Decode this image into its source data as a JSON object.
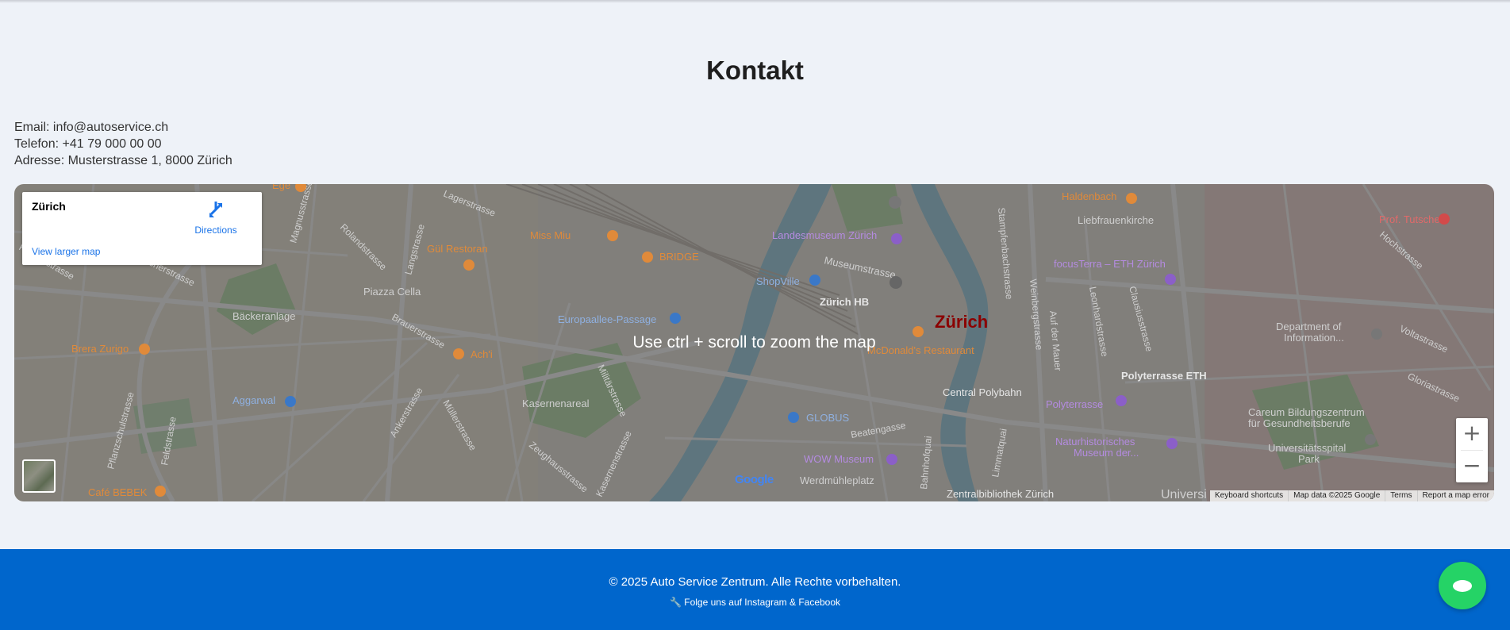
{
  "page": {
    "title": "Kontakt"
  },
  "contact": {
    "email": "Email: info@autoservice.ch",
    "phone": "Telefon: +41 79 000 00 00",
    "address": "Adresse: Musterstrasse 1, 8000 Zürich"
  },
  "map": {
    "scroll_hint": "Use ctrl + scroll to zoom the map",
    "place_name": "Zürich",
    "directions_label": "Directions",
    "larger_map_label": "View larger map",
    "zoom_in": "+",
    "zoom_out": "−",
    "logo_text": "Google",
    "attribution": {
      "shortcuts": "Keyboard shortcuts",
      "data": "Map data ©2025 Google",
      "terms": "Terms",
      "report": "Report a map error"
    },
    "labels": {
      "zurich": "Zürich",
      "zurich_hb": "Zürich HB",
      "landesmuseum": "Landesmuseum Zürich",
      "shopville": "ShopVille",
      "museumstrasse": "Museumstrasse",
      "liebfrauenkirche": "Liebfrauenkirche",
      "haldenbach": "Haldenbach",
      "focusterra": "focusTerra – ETH Zürich",
      "tutschek": "Prof. Tutschek",
      "miss_miu": "Miss Miu",
      "gul": "Gül Restoran",
      "bridge": "BRIDGE",
      "piazza": "Piazza Cella",
      "baeckeranlage": "Bäckeranlage",
      "europaallee": "Europaallee-Passage",
      "brera": "Brera Zurigo",
      "achi": "Ach'i",
      "aggarwal": "Aggarwal",
      "kasernenareal": "Kasernenareal",
      "globus": "GLOBUS",
      "wow": "WOW Museum",
      "werdmuehle": "Werdmühleplatz",
      "mcdonalds": "McDonald's Restaurant",
      "central": "Central Polybahn",
      "polyterrasse_eth": "Polyterrasse ETH",
      "polyterrasse": "Polyterrasse",
      "naturhist1": "Naturhistorisches",
      "naturhist2": "Museum der...",
      "zentralbib": "Zentralbibliothek Zürich",
      "universitaet": "Universi",
      "dept1": "Department of",
      "dept2": "Information...",
      "careum1": "Careum Bildungszentrum",
      "careum2": "für Gesundheitsberufe",
      "unipark1": "Universitätsspital",
      "unipark2": "Park",
      "cafe": "Café BEBEK",
      "ege": "Ege",
      "langstrasse": "Langstrasse",
      "lagerstrasse": "Lagerstrasse",
      "stauffacher": "Stauffacherstrasse",
      "kanzlei": "Kanzleistrasse",
      "ankerstrasse": "Ankerstrasse",
      "muellerstrasse": "Müllerstrasse",
      "militaer": "Militärstrasse",
      "zeughaus": "Zeughausstrasse",
      "kasernenstrasse": "Kasernenstrasse",
      "beatengasse": "Beatengasse",
      "bahnhofquai": "Bahnhofquai",
      "limmatquai": "Limmatquai",
      "weinberg": "Weinbergstrasse",
      "leonhard": "Leonhardstrasse",
      "clausius": "Clausiusstrasse",
      "volta": "Voltastrasse",
      "gloria": "Gloriastrasse",
      "hochstrasse": "Hochstrasse",
      "stampfen": "Stampfenbachstrasse",
      "aufdermauer": "Auf der Mauer",
      "brauerstrasse": "Brauerstrasse",
      "rolandstrasse": "Rolandstrasse",
      "magnusstrasse": "Magnusstrasse",
      "feldstrasse": "Feldstrasse",
      "pflanzschul": "Pflanzschulstrasse"
    }
  },
  "footer": {
    "copyright": "© 2025 Auto Service Zentrum. Alle Rechte vorbehalten.",
    "social": "🔧 Folge uns auf Instagram & Facebook"
  },
  "colors": {
    "page_bg": "#eef2f8",
    "footer_bg": "#0066cc",
    "chat_button": "#25d366",
    "link": "#1a73e8"
  },
  "icons": {
    "directions": "directions-icon",
    "chat": "chat-icon"
  }
}
